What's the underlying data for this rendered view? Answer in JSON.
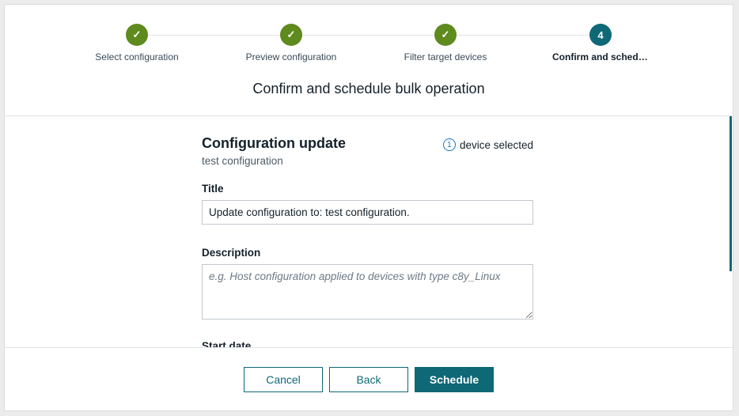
{
  "stepper": {
    "steps": [
      {
        "label": "Select configuration",
        "state": "done",
        "icon": "check-icon"
      },
      {
        "label": "Preview configuration",
        "state": "done",
        "icon": "check-icon"
      },
      {
        "label": "Filter target devices",
        "state": "done",
        "icon": "check-icon"
      },
      {
        "label": "Confirm and schedule bulk operation",
        "state": "current",
        "number": "4"
      }
    ]
  },
  "dialog_title": "Confirm and schedule bulk operation",
  "operation": {
    "title": "Configuration update",
    "subtitle": "test configuration",
    "device_count": "1",
    "device_text": "device selected"
  },
  "form": {
    "title_label": "Title",
    "title_value": "Update configuration to: test configuration.",
    "description_label": "Description",
    "description_placeholder": "e.g. Host configuration applied to devices with type c8y_Linux",
    "start_date_label": "Start date"
  },
  "footer": {
    "cancel_label": "Cancel",
    "back_label": "Back",
    "schedule_label": "Schedule"
  },
  "colors": {
    "done": "#5f8a1e",
    "current": "#0e6876",
    "accent": "#0e6876",
    "badge": "#1776bf"
  }
}
